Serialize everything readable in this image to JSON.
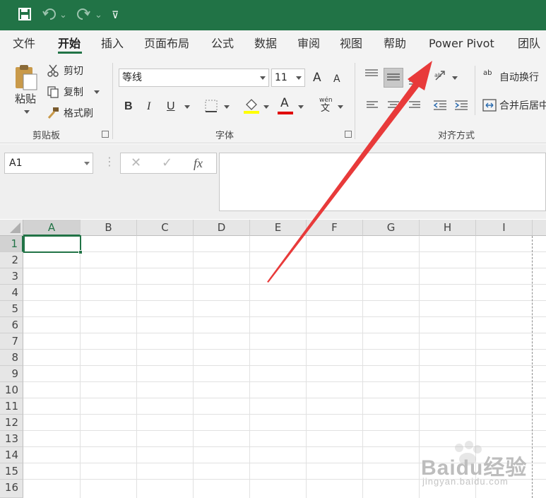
{
  "title_bar": {
    "save_icon": "save-icon",
    "undo_icon": "undo-icon",
    "redo_icon": "redo-icon",
    "customize_icon": "customize-quick-access-icon",
    "dropdown_glyph": "⌄",
    "customize_glyph": "⊽"
  },
  "tabs": [
    {
      "label": "文件"
    },
    {
      "label": "开始"
    },
    {
      "label": "插入"
    },
    {
      "label": "页面布局"
    },
    {
      "label": "公式"
    },
    {
      "label": "数据"
    },
    {
      "label": "审阅"
    },
    {
      "label": "视图"
    },
    {
      "label": "帮助"
    },
    {
      "label": "Power Pivot"
    },
    {
      "label": "团队"
    }
  ],
  "ribbon": {
    "clipboard": {
      "paste_label": "粘贴",
      "cut_label": "剪切",
      "copy_label": "复制",
      "format_painter_label": "格式刷",
      "group_label": "剪贴板"
    },
    "font": {
      "font_name": "等线",
      "font_size": "11",
      "grow_label": "A",
      "shrink_label": "A",
      "bold_label": "B",
      "italic_label": "I",
      "underline_label": "U",
      "font_color_label": "A",
      "phonetic_top": "wén",
      "phonetic_bottom": "文",
      "fill_color": "#ffff00",
      "font_color": "#e00000",
      "group_label": "字体"
    },
    "alignment": {
      "wrap_label": "自动换行",
      "wrap_icon_text": "ab",
      "merge_label": "合并后居中",
      "group_label": "对齐方式"
    }
  },
  "formula_bar": {
    "name_box_value": "A1",
    "cancel_glyph": "✕",
    "enter_glyph": "✓",
    "fx_label": "fx",
    "formula_value": ""
  },
  "grid": {
    "columns": [
      "A",
      "B",
      "C",
      "D",
      "E",
      "F",
      "G",
      "H",
      "I"
    ],
    "rows": [
      "1",
      "2",
      "3",
      "4",
      "5",
      "6",
      "7",
      "8",
      "9",
      "10",
      "11",
      "12",
      "13",
      "14",
      "15",
      "16"
    ],
    "active_cell": "A1"
  },
  "watermark": {
    "brand": "Baidu经验",
    "url": "jingyan.baidu.com"
  },
  "colors": {
    "accent": "#217346",
    "arrow": "#e83a3a"
  }
}
